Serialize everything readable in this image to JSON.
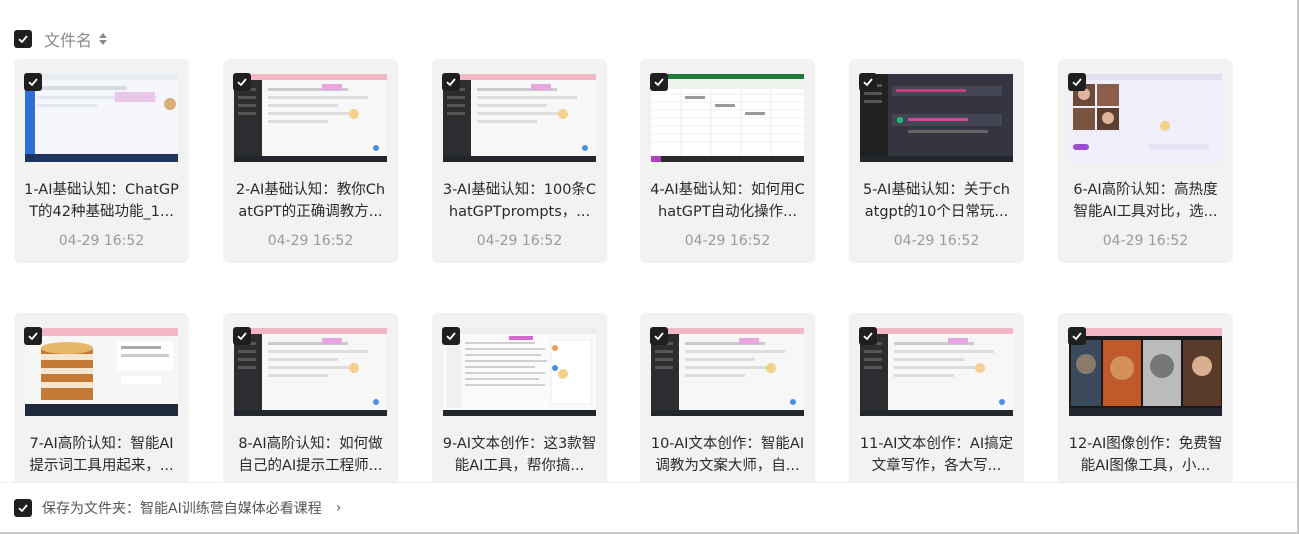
{
  "header": {
    "select_all_checked": true,
    "column_title": "文件名"
  },
  "files": [
    {
      "name": "1-AI基础认知：ChatGPT的42种基础功能_1...",
      "date": "04-29 16:52",
      "thumb": "light-blue-taskbar"
    },
    {
      "name": "2-AI基础认知：教你ChatGPT的正确调教方...",
      "date": "04-29 16:52",
      "thumb": "dark-sidebar-doc"
    },
    {
      "name": "3-AI基础认知：100条ChatGPTprompts，...",
      "date": "04-29 16:52",
      "thumb": "dark-sidebar-doc"
    },
    {
      "name": "4-AI基础认知：如何用ChatGPT自动化操作...",
      "date": "04-29 16:52",
      "thumb": "spreadsheet"
    },
    {
      "name": "5-AI基础认知：关于chatgpt的10个日常玩...",
      "date": "04-29 16:52",
      "thumb": "dark-chat"
    },
    {
      "name": "6-AI高阶认知：高热度智能AI工具对比，选...",
      "date": "04-29 16:52",
      "thumb": "image-gallery"
    },
    {
      "name": "7-AI高阶认知：智能AI提示词工具用起来，...",
      "date": "",
      "thumb": "cake"
    },
    {
      "name": "8-AI高阶认知：如何做自己的AI提示工程师...",
      "date": "",
      "thumb": "dark-sidebar-doc"
    },
    {
      "name": "9-AI文本创作：这3款智能AI工具，帮你搞...",
      "date": "",
      "thumb": "text-doc"
    },
    {
      "name": "10-AI文本创作：智能AI调教为文案大师，自...",
      "date": "",
      "thumb": "dark-sidebar-doc"
    },
    {
      "name": "11-AI文本创作：AI搞定文章写作，各大写...",
      "date": "",
      "thumb": "dark-sidebar-doc"
    },
    {
      "name": "12-AI图像创作：免费智能AI图像工具，小...",
      "date": "",
      "thumb": "dark-portraits"
    }
  ],
  "footer": {
    "checked": true,
    "save_label": "保存为文件夹：智能AI训练营自媒体必看课程",
    "chevron": "›"
  }
}
